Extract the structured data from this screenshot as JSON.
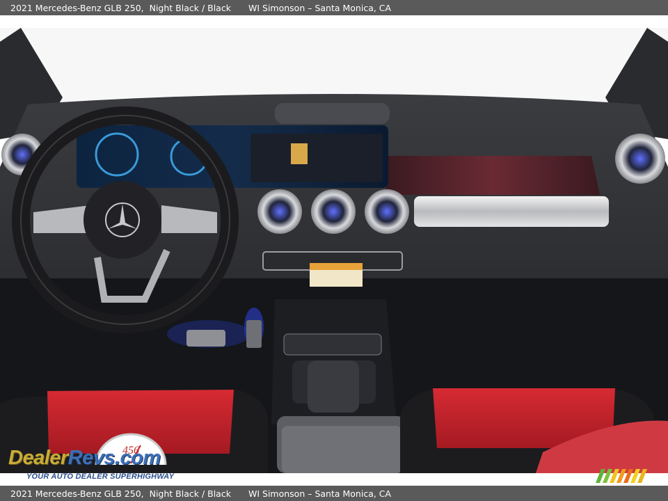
{
  "header": {
    "vehicle_title": "2021 Mercedes-Benz GLB 250,  Night Black / Black",
    "dealer": "WI Simonson – Santa Monica, CA"
  },
  "footer": {
    "vehicle_title": "2021 Mercedes-Benz GLB 250,  Night Black / Black",
    "dealer": "WI Simonson – Santa Monica, CA"
  },
  "watermark": {
    "brand_part1": "Dealer",
    "brand_part2": "Revs",
    "brand_part3": ".com",
    "tagline": "YOUR AUTO DEALER SUPERHIGHWAY",
    "gauge_digits": "456"
  },
  "photo": {
    "subject": "dashboard-interior",
    "colors": {
      "seat_accent": "#c8222b",
      "dash": "#2e2f33",
      "ambient": "#3a4fd8"
    }
  }
}
